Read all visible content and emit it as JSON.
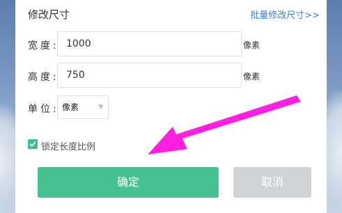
{
  "dialog": {
    "title": "修改尺寸",
    "batch_link": "批量修改尺寸>>"
  },
  "width_row": {
    "label": "宽度:",
    "value": "1000",
    "unit": "像素"
  },
  "height_row": {
    "label": "高度:",
    "value": "750",
    "unit": "像素"
  },
  "unit_row": {
    "label": "单位:",
    "selected": "像素"
  },
  "lock_ratio": {
    "label": "锁定长度比例",
    "checked": true
  },
  "buttons": {
    "confirm": "确定",
    "cancel": "取消"
  },
  "colors": {
    "accent": "#46c192",
    "checkbox": "#3dbd8d",
    "link": "#3d7cc9",
    "cancel_bg": "#cfd2d6",
    "annotation_arrow": "#ff1fe0"
  }
}
